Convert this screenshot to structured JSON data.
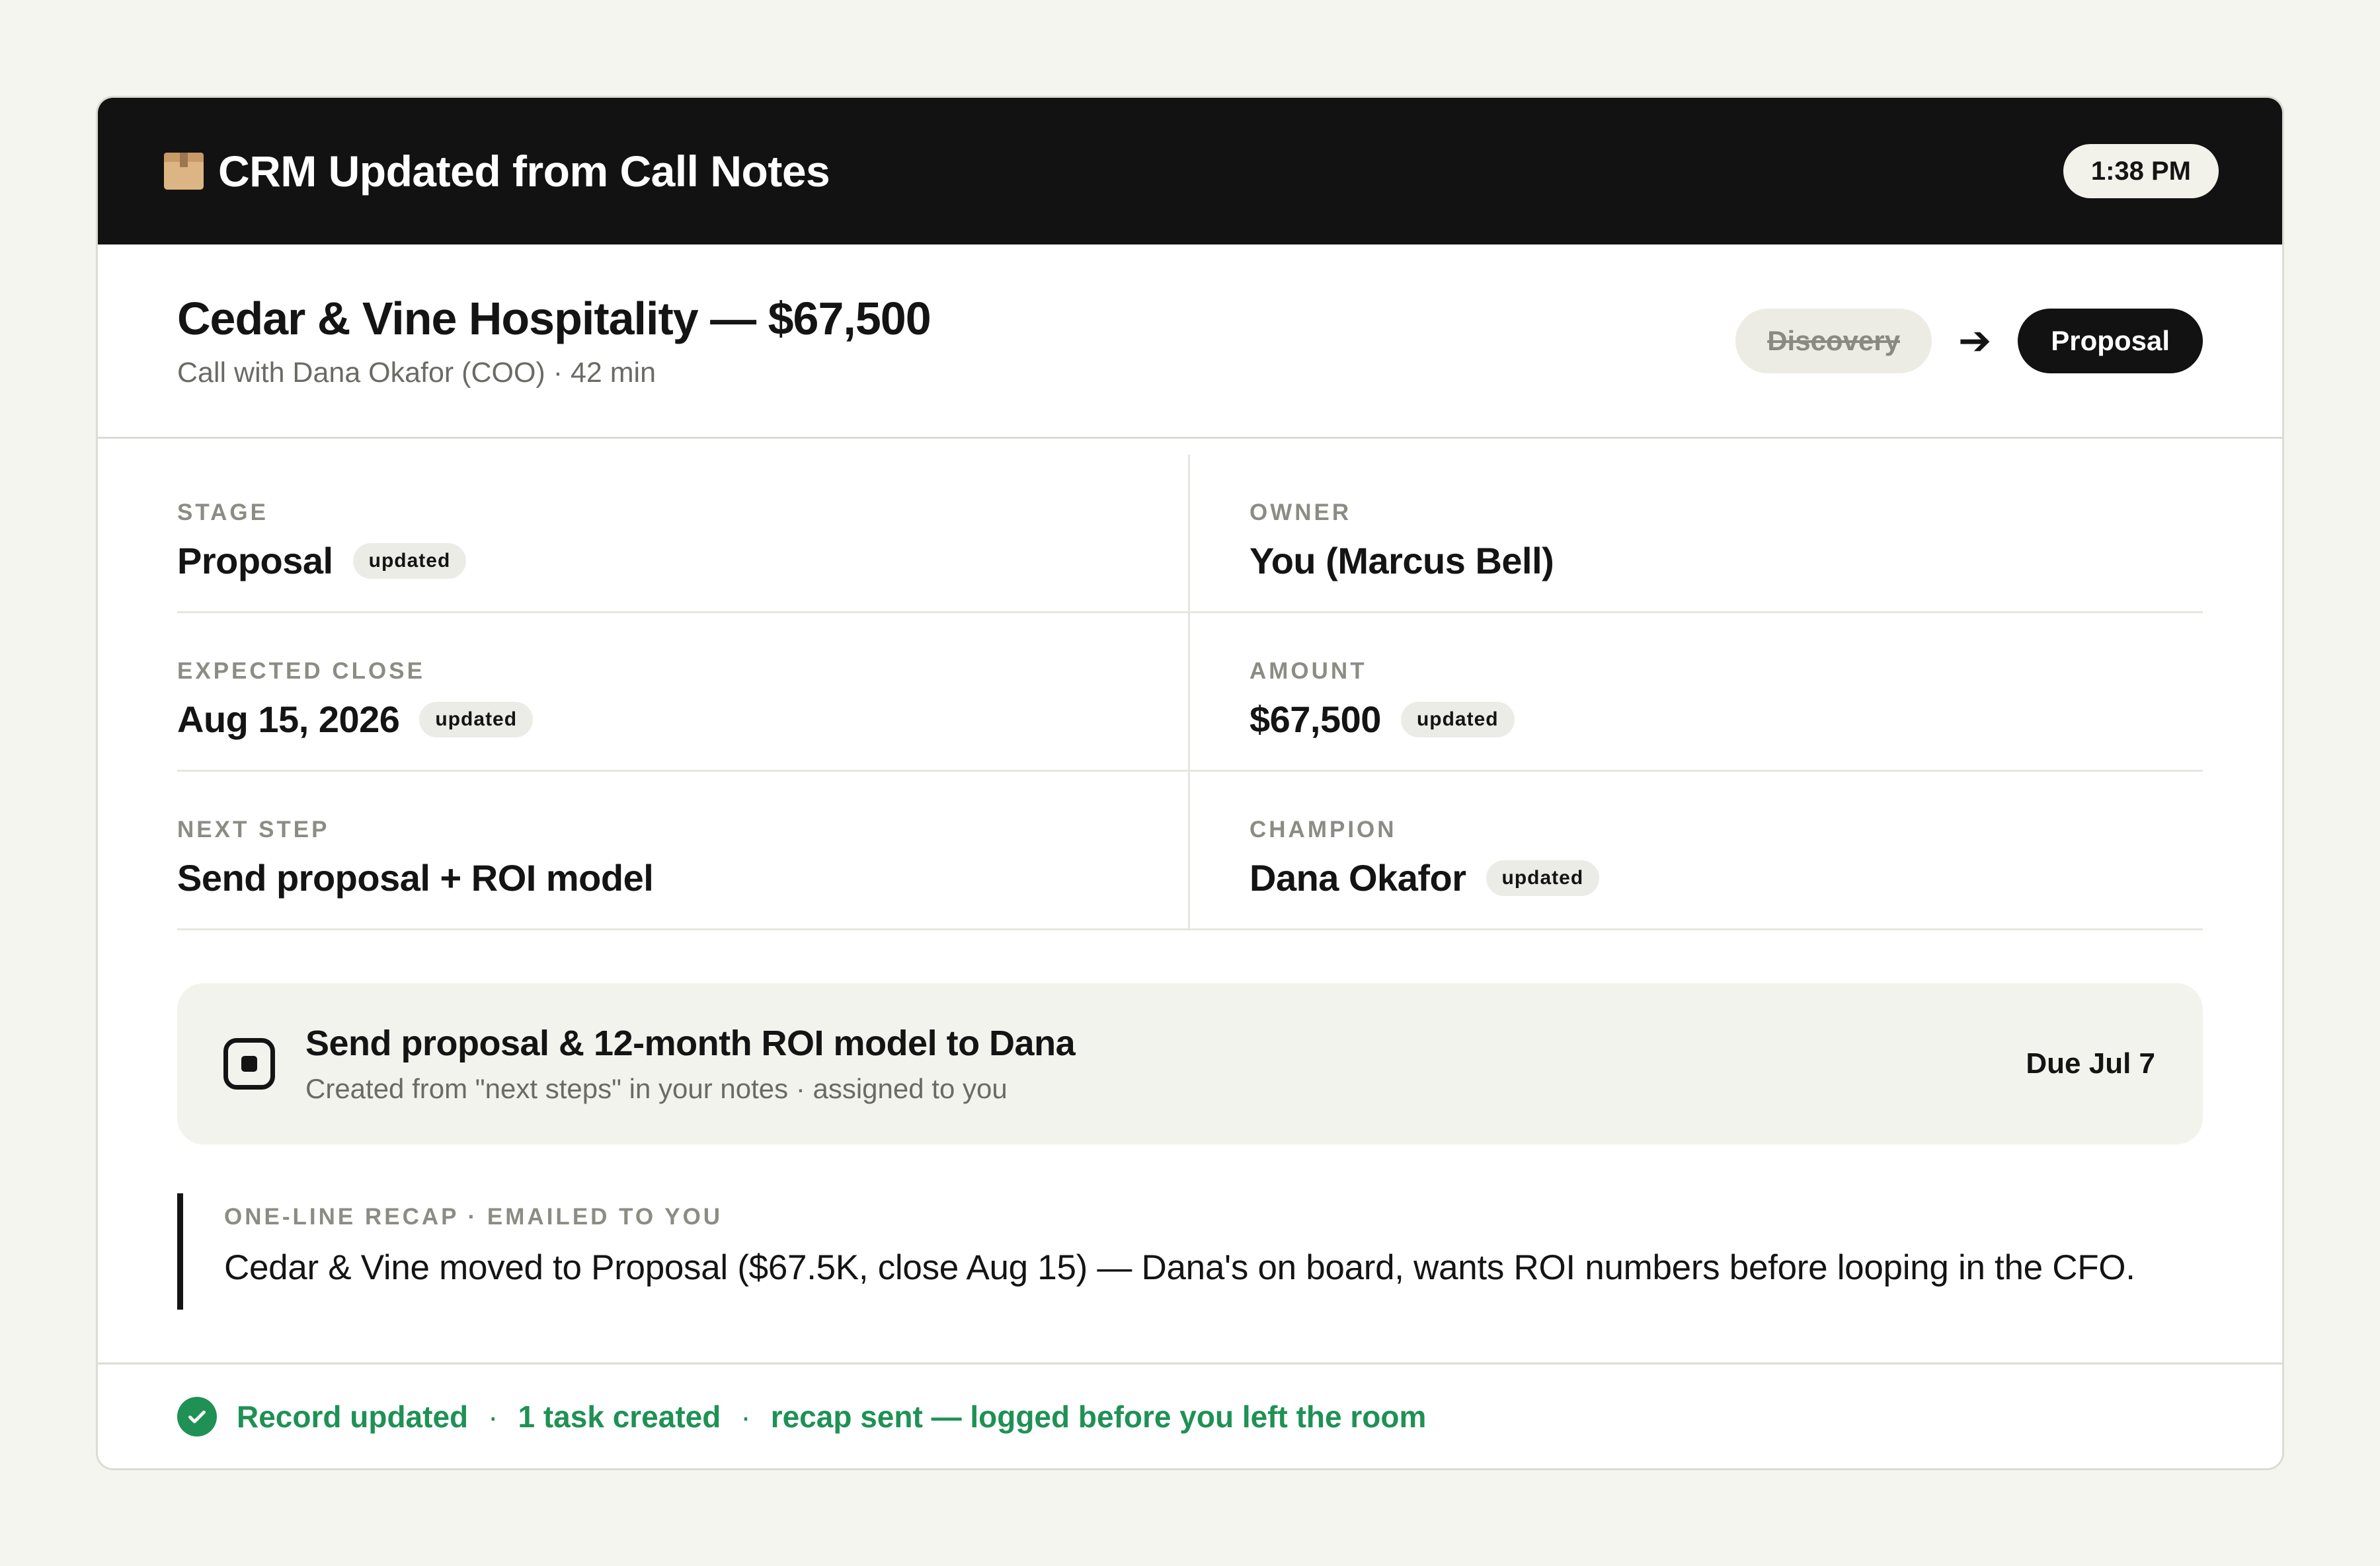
{
  "header": {
    "icon": "package-box-icon",
    "title": "CRM Updated from Call Notes",
    "time": "1:38 PM"
  },
  "deal": {
    "title": "Cedar & Vine Hospitality — $67,500",
    "subtitle": "Call with Dana Okafor (COO) · 42 min",
    "stage_from": "Discovery",
    "stage_to": "Proposal"
  },
  "fields": {
    "stage": {
      "label": "STAGE",
      "value": "Proposal",
      "tag": "updated"
    },
    "owner": {
      "label": "OWNER",
      "value": "You (Marcus Bell)"
    },
    "expected_close": {
      "label": "EXPECTED CLOSE",
      "value": "Aug 15, 2026",
      "tag": "updated"
    },
    "amount": {
      "label": "AMOUNT",
      "value": "$67,500",
      "tag": "updated"
    },
    "next_step": {
      "label": "NEXT STEP",
      "value": "Send proposal + ROI model"
    },
    "champion": {
      "label": "CHAMPION",
      "value": "Dana Okafor",
      "tag": "updated"
    }
  },
  "task": {
    "title": "Send proposal & 12-month ROI model to Dana",
    "subtitle": "Created from \"next steps\" in your notes · assigned to you",
    "due": "Due Jul 7"
  },
  "recap": {
    "label": "ONE-LINE RECAP · EMAILED TO YOU",
    "text": "Cedar & Vine moved to Proposal ($67.5K, close Aug 15) — Dana's on board, wants ROI numbers before looping in the CFO."
  },
  "footer": {
    "item1": "Record updated",
    "item2": "1 task created",
    "item3": "recap sent — logged before you left the room",
    "separator": "·"
  },
  "colors": {
    "header_bg": "#121212",
    "success": "#1f9155",
    "page_bg": "#f5f5f0"
  }
}
